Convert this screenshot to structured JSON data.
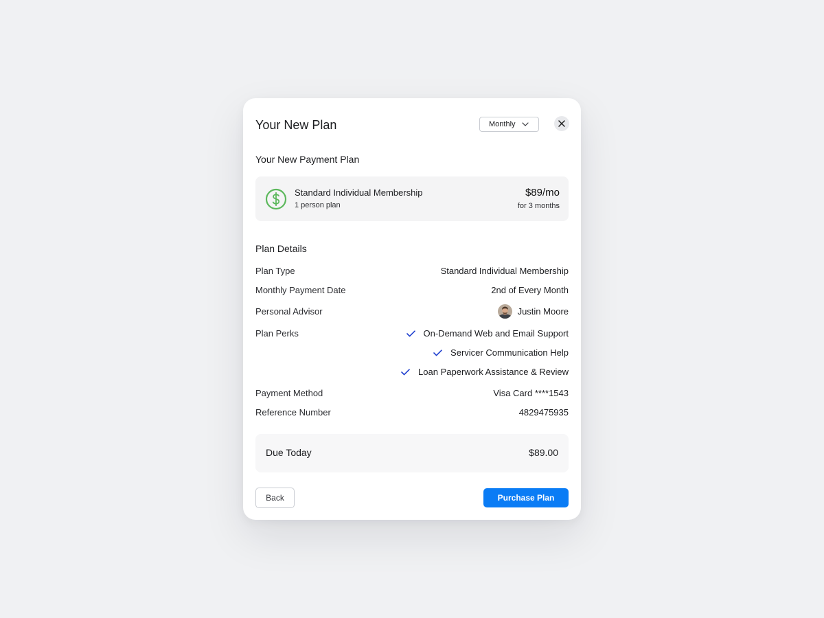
{
  "modal": {
    "title": "Your New Plan",
    "period_select": {
      "value": "Monthly"
    },
    "close_icon": "close-icon"
  },
  "payment_plan": {
    "heading": "Your New Payment Plan",
    "icon": "dollar-circle-icon",
    "icon_color": "#5cb85c",
    "name": "Standard Individual Membership",
    "subtitle": "1 person plan",
    "price": "$89/mo",
    "term": "for 3 months"
  },
  "plan_details": {
    "heading": "Plan Details",
    "plan_type": {
      "label": "Plan Type",
      "value": "Standard Individual Membership"
    },
    "payment_date": {
      "label": "Monthly Payment Date",
      "value": "2nd of Every Month"
    },
    "advisor": {
      "label": "Personal Advisor",
      "name": "Justin Moore"
    },
    "perks": {
      "label": "Plan Perks",
      "check_color": "#1f3fcf",
      "items": [
        "On-Demand Web and Email Support",
        "Servicer Communication Help",
        "Loan Paperwork Assistance & Review"
      ]
    },
    "payment_method": {
      "label": "Payment Method",
      "value": "Visa Card ****1543"
    },
    "reference": {
      "label": "Reference Number",
      "value": "4829475935"
    }
  },
  "due": {
    "label": "Due Today",
    "amount": "$89.00"
  },
  "footer": {
    "back_label": "Back",
    "purchase_label": "Purchase Plan",
    "accent": "#0a7cf5"
  }
}
